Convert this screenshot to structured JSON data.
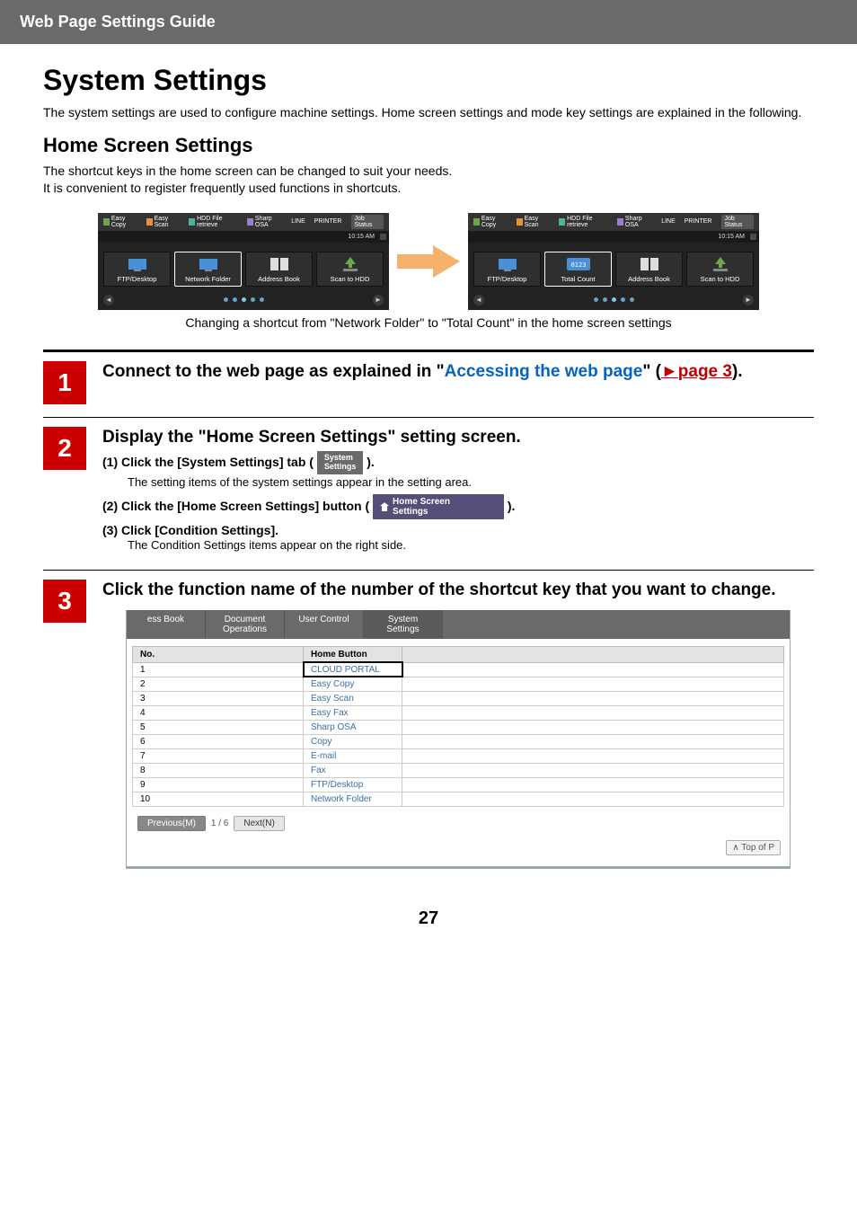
{
  "header": "Web Page Settings Guide",
  "title": "System Settings",
  "intro": "The system settings are used to configure machine settings. Home screen settings and mode key settings are explained in the following.",
  "section": {
    "title": "Home Screen Settings",
    "desc1": "The shortcut keys in the home screen can be changed to suit your needs.",
    "desc2": "It is convenient to register frequently used functions in shortcuts."
  },
  "panels": {
    "top": {
      "easy_copy": "Easy\nCopy",
      "easy_scan": "Easy\nScan",
      "hdd": "HDD\nFile retrieve",
      "sharp_osa": "Sharp OSA",
      "line": "LINE",
      "printer": "PRINTER",
      "job_status": "Job Status"
    },
    "time": "10:15 AM",
    "left": {
      "b1": "FTP/Desktop",
      "b2": "Network Folder",
      "b3": "Address Book",
      "b4": "Scan to HDD"
    },
    "right": {
      "b1": "FTP/Desktop",
      "b2": "Total Count",
      "b3": "Address Book",
      "b4": "Scan to HDD"
    },
    "caption": "Changing a shortcut from \"Network Folder\" to \"Total Count\" in the home screen settings"
  },
  "steps": {
    "s1": {
      "num": "1",
      "pre": "Connect to the web page as explained in \"",
      "link": "Accessing the web page",
      "mid": "\" (",
      "ref_arrow": "►",
      "ref": "page 3",
      "post": ")."
    },
    "s2": {
      "num": "2",
      "title": "Display the \"Home Screen Settings\" setting screen.",
      "i1_label": "(1)  Click the [System Settings] tab (",
      "i1_tab": "System\nSettings",
      "i1_close": ").",
      "i1_text": "The setting items of the system settings appear in the setting area.",
      "i2_label": "(2)  Click the [Home Screen Settings] button (",
      "i2_btn": "Home Screen\nSettings",
      "i2_close": ").",
      "i3_label": "(3)  Click [Condition Settings].",
      "i3_text": "The Condition Settings items appear on the right side."
    },
    "s3": {
      "num": "3",
      "title": "Click the function name of the number of the shortcut key that you want to change."
    }
  },
  "ui": {
    "tabs": {
      "ess": "ess Book",
      "doc": "Document\nOperations",
      "user": "User Control",
      "sys": "System\nSettings"
    },
    "th_no": "No.",
    "th_home": "Home Button",
    "rows": [
      {
        "no": "1",
        "name": "CLOUD PORTAL",
        "boxed": true
      },
      {
        "no": "2",
        "name": "Easy Copy"
      },
      {
        "no": "3",
        "name": "Easy Scan"
      },
      {
        "no": "4",
        "name": "Easy Fax"
      },
      {
        "no": "5",
        "name": "Sharp OSA"
      },
      {
        "no": "6",
        "name": "Copy"
      },
      {
        "no": "7",
        "name": "E-mail"
      },
      {
        "no": "8",
        "name": "Fax"
      },
      {
        "no": "9",
        "name": "FTP/Desktop"
      },
      {
        "no": "10",
        "name": "Network Folder"
      }
    ],
    "prev": "Previous(M)",
    "page": "1 / 6",
    "next": "Next(N)",
    "top": "∧ Top of P"
  },
  "page_num": "27"
}
